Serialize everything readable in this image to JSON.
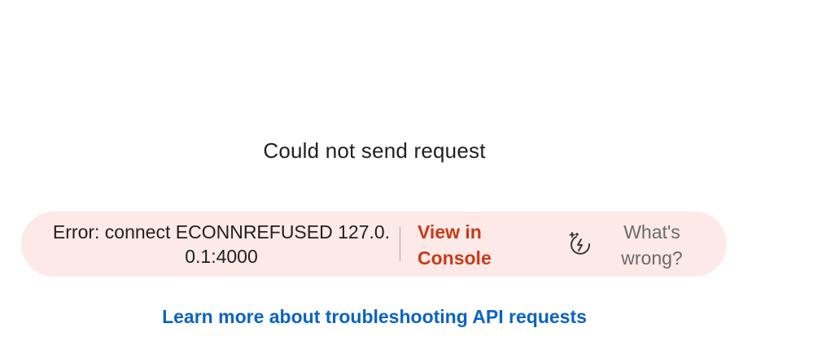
{
  "response": {
    "title": "Could not send request",
    "error": {
      "message": "Error: connect ECONNREFUSED 127.0.0.1:4000",
      "view_console_label": "View in Console",
      "ask_ai_icon": "sparkle-wrench-icon",
      "whats_wrong_label": "What's wrong?"
    },
    "learn_more_label": "Learn more about troubleshooting API requests"
  },
  "colors": {
    "banner_background": "#fde9e7",
    "console_link": "#c93a1a",
    "learn_link": "#0b63c4",
    "secondary_text": "#6b6b6b"
  }
}
